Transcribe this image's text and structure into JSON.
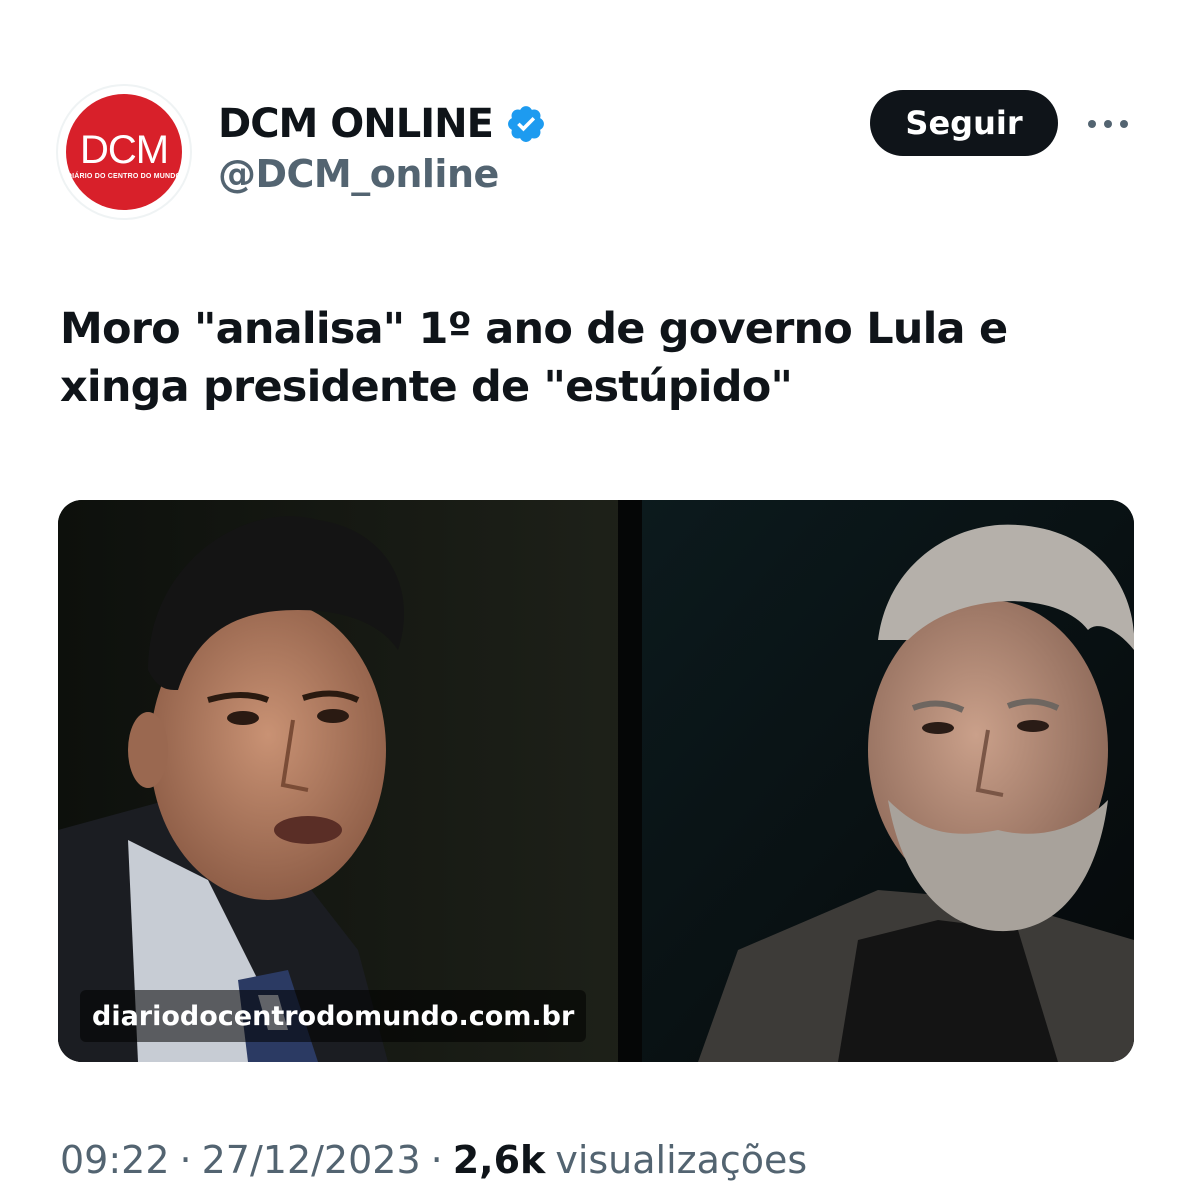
{
  "author": {
    "avatar_text": "DCM",
    "avatar_subtext": "DIÁRIO DO CENTRO DO MUNDO",
    "display_name": "DCM ONLINE",
    "handle": "@DCM_online",
    "verified": true
  },
  "actions": {
    "follow_label": "Seguir",
    "more_icon": "more-horizontal-icon"
  },
  "post": {
    "headline": "Moro \"analisa\" 1º ano de governo Lula e xinga presidente de \"estúpido\"",
    "media_source": "diariodocentrodomundo.com.br"
  },
  "meta": {
    "time": "09:22",
    "separator": "·",
    "date": "27/12/2023",
    "views_count": "2,6k",
    "views_label": "visualizações"
  },
  "colors": {
    "text_primary": "#0f1419",
    "text_secondary": "#536471",
    "verified_blue": "#1d9bf0",
    "avatar_red": "#d8202a",
    "button_bg": "#0f1419"
  }
}
